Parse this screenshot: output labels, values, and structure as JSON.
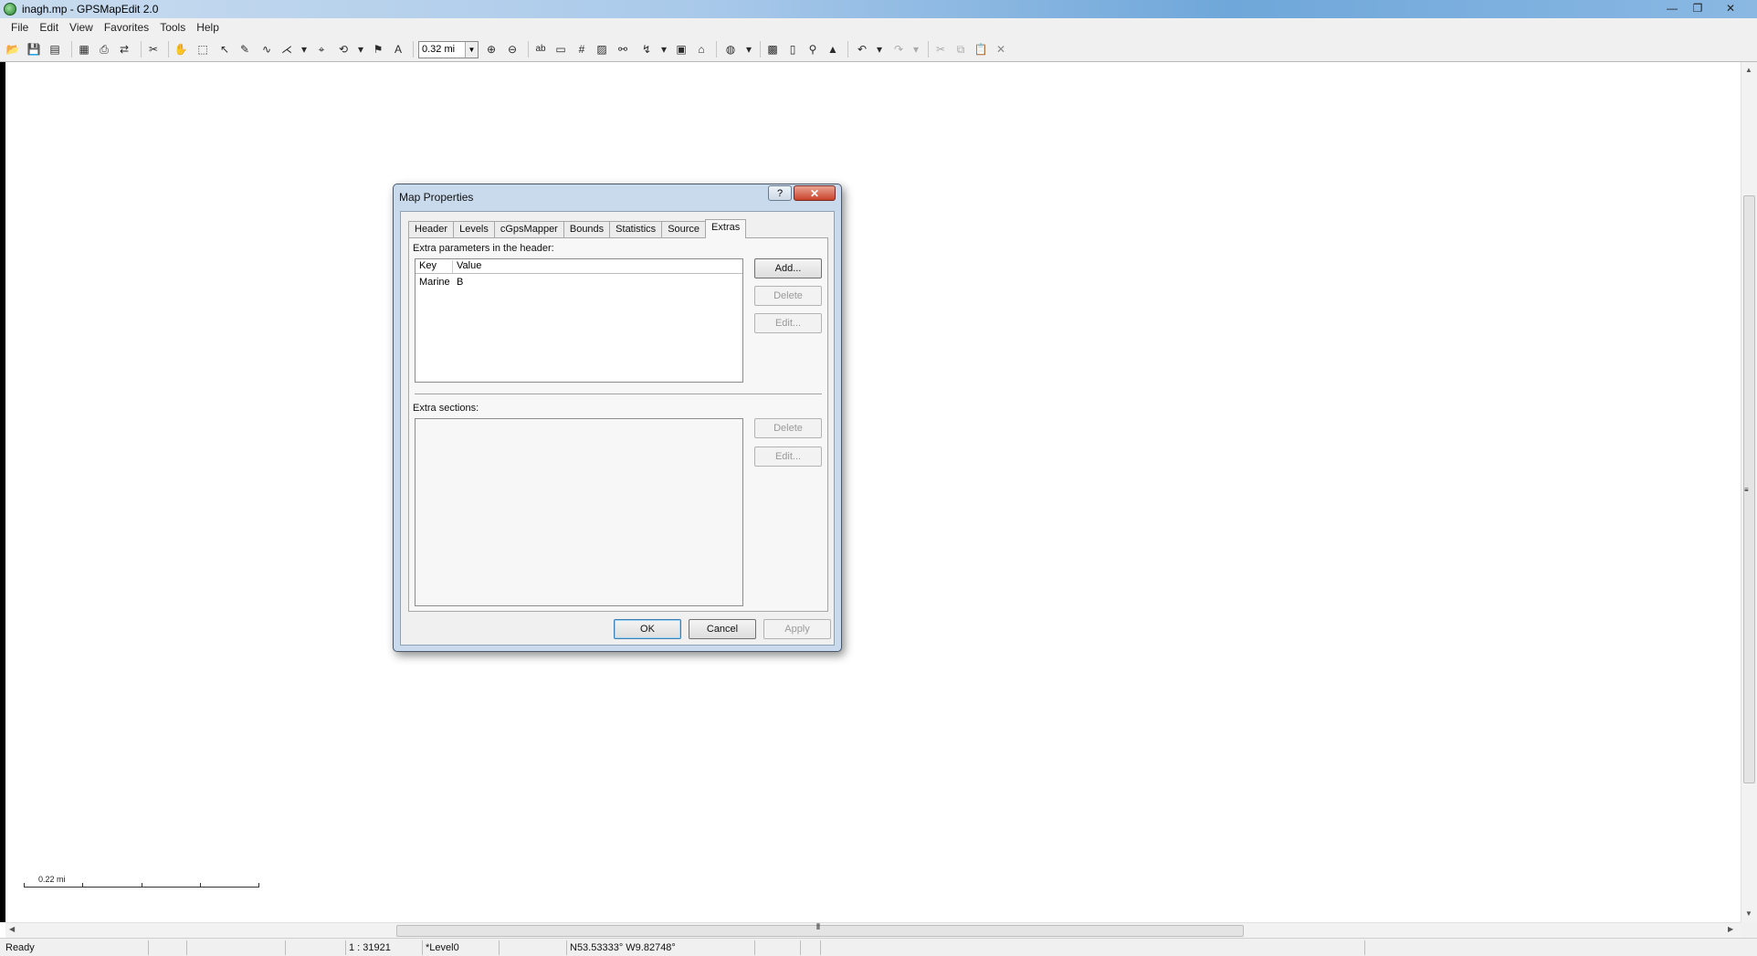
{
  "window": {
    "title": "inagh.mp - GPSMapEdit 2.0",
    "controls": [
      "—",
      "❐",
      "✕"
    ]
  },
  "menu": [
    "File",
    "Edit",
    "View",
    "Favorites",
    "Tools",
    "Help"
  ],
  "toolbar": {
    "scale_value": "0.32 mi"
  },
  "map": {
    "scale_label": "0.22 mi"
  },
  "dialog": {
    "title": "Map Properties",
    "help_glyph": "?",
    "close_glyph": "✕",
    "tabs": [
      "Header",
      "Levels",
      "cGpsMapper",
      "Bounds",
      "Statistics",
      "Source",
      "Extras"
    ],
    "active_tab": "Extras",
    "extras": {
      "header_params_label": "Extra parameters in the header:",
      "columns": [
        "Key",
        "Value"
      ],
      "rows": [
        {
          "key": "Marine",
          "value": "B"
        }
      ],
      "add_label": "Add...",
      "delete_label": "Delete",
      "edit_label": "Edit...",
      "sections_label": "Extra sections:",
      "sections_delete_label": "Delete",
      "sections_edit_label": "Edit..."
    },
    "ok_label": "OK",
    "cancel_label": "Cancel",
    "apply_label": "Apply"
  },
  "status": {
    "ready": "Ready",
    "scale": "1 : 31921",
    "level": "*Level0",
    "coords": "N53.53333° W9.82748°"
  }
}
